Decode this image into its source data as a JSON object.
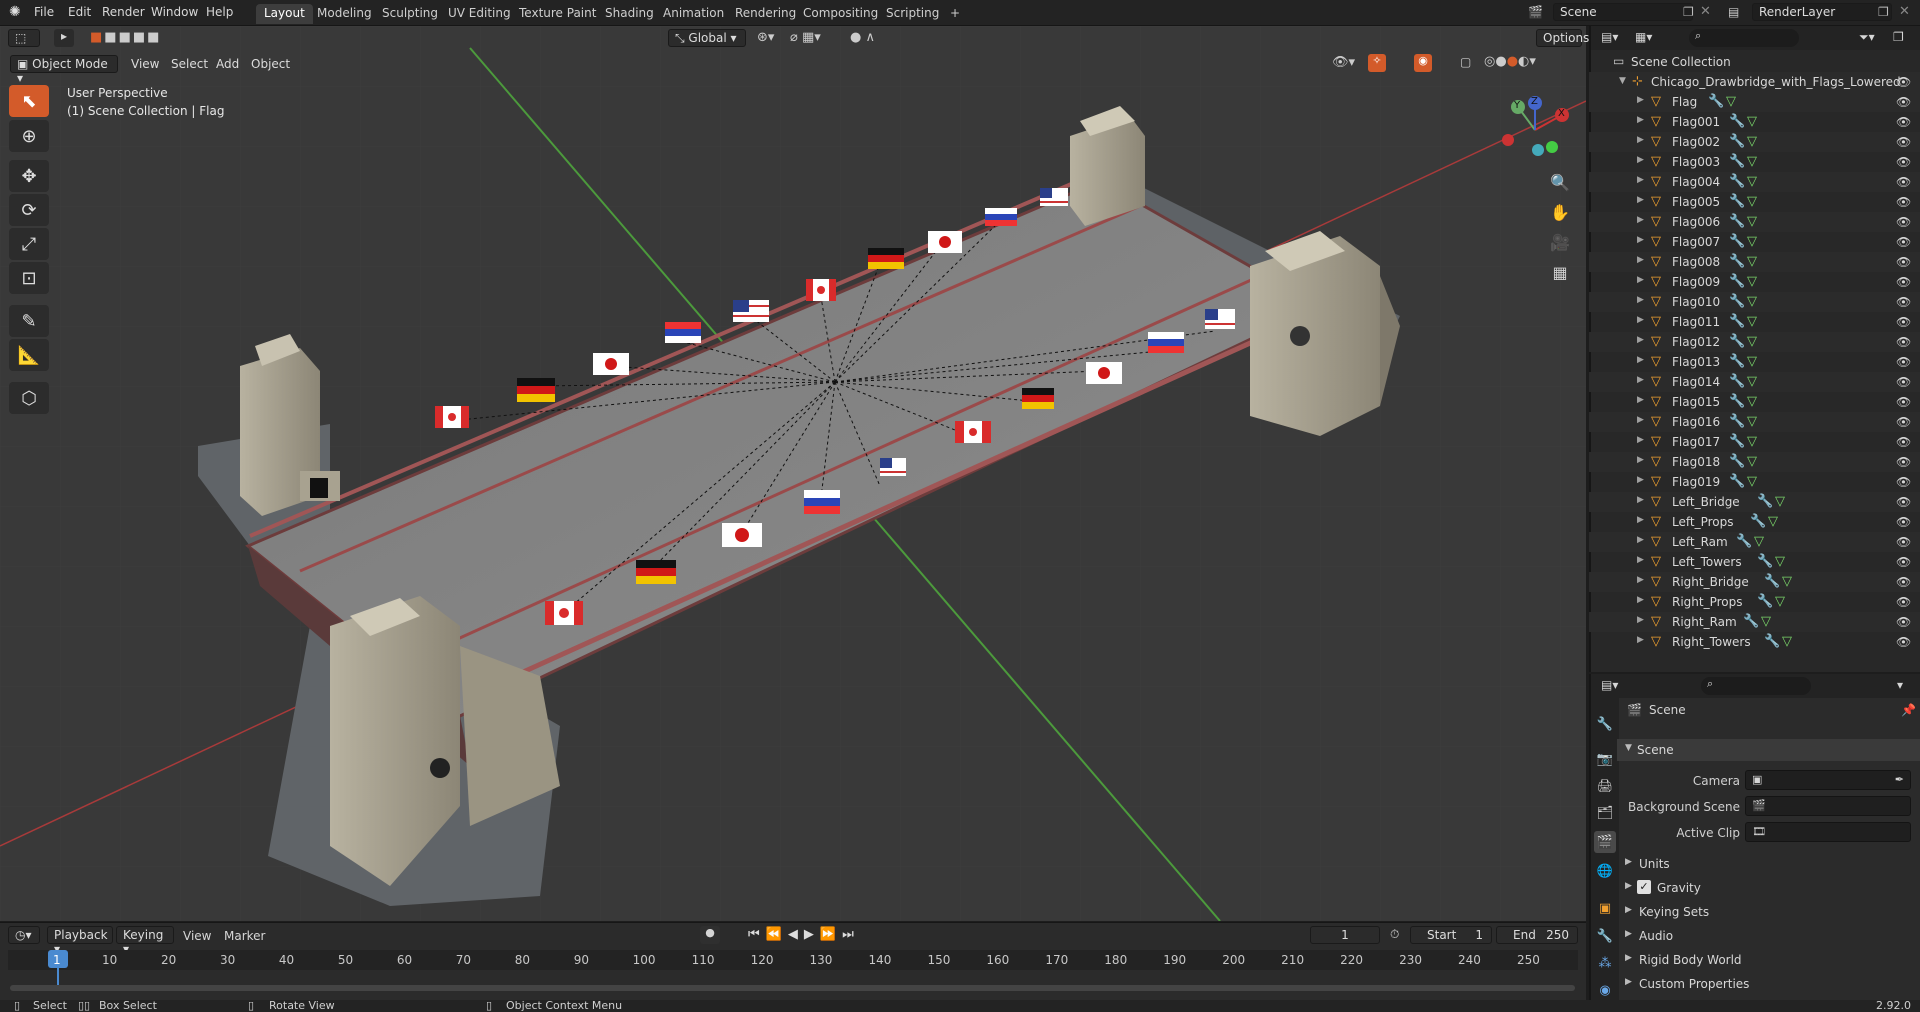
{
  "topbar": {
    "menus": [
      "File",
      "Edit",
      "Render",
      "Window",
      "Help"
    ],
    "workspaces": [
      "Layout",
      "Modeling",
      "Sculpting",
      "UV Editing",
      "Texture Paint",
      "Shading",
      "Animation",
      "Rendering",
      "Compositing",
      "Scripting"
    ],
    "active_workspace": "Layout",
    "add_tab": "+",
    "scene_name": "Scene",
    "view_layer": "RenderLayer"
  },
  "viewport": {
    "mode": "Object Mode",
    "menus": [
      "View",
      "Select",
      "Add",
      "Object"
    ],
    "transform_orientation": "Global",
    "options_label": "Options",
    "overlay_title": "User Perspective",
    "overlay_subtitle": "(1) Scene Collection | Flag",
    "gizmo": {
      "x": "X",
      "y": "Y",
      "z": "Z"
    }
  },
  "outliner": {
    "root": "Scene Collection",
    "collection": "Chicago_Drawbridge_with_Flags_Lowered",
    "objects": [
      "Flag",
      "Flag001",
      "Flag002",
      "Flag003",
      "Flag004",
      "Flag005",
      "Flag006",
      "Flag007",
      "Flag008",
      "Flag009",
      "Flag010",
      "Flag011",
      "Flag012",
      "Flag013",
      "Flag014",
      "Flag015",
      "Flag016",
      "Flag017",
      "Flag018",
      "Flag019",
      "Left_Bridge",
      "Left_Props",
      "Left_Ram",
      "Left_Towers",
      "Right_Bridge",
      "Right_Props",
      "Right_Ram",
      "Right_Towers"
    ]
  },
  "properties": {
    "context": "Scene",
    "panel": "Scene",
    "fields": {
      "camera": "Camera",
      "background_scene": "Background Scene",
      "active_clip": "Active Clip"
    },
    "subpanels": {
      "units": "Units",
      "gravity": "Gravity",
      "keying_sets": "Keying Sets",
      "audio": "Audio",
      "rigid_body_world": "Rigid Body World",
      "custom_properties": "Custom Properties"
    },
    "gravity_checked": true
  },
  "timeline": {
    "menus": [
      "Playback",
      "Keying",
      "View",
      "Marker"
    ],
    "current_frame": "1",
    "start_label": "Start",
    "start": "1",
    "end_label": "End",
    "end": "250",
    "ticks": [
      "1",
      "10",
      "20",
      "30",
      "40",
      "50",
      "60",
      "70",
      "80",
      "90",
      "100",
      "110",
      "120",
      "130",
      "140",
      "150",
      "160",
      "170",
      "180",
      "190",
      "200",
      "210",
      "220",
      "230",
      "240",
      "250"
    ]
  },
  "statusbar": {
    "select": "Select",
    "box_select": "Box Select",
    "rotate_view": "Rotate View",
    "context_menu": "Object Context Menu",
    "version": "2.92.0"
  },
  "colors": {
    "accent": "#d35b2a",
    "active_tab": "#3d3d3d",
    "x_axis": "#b83b3b",
    "y_axis": "#4c9a3c"
  }
}
